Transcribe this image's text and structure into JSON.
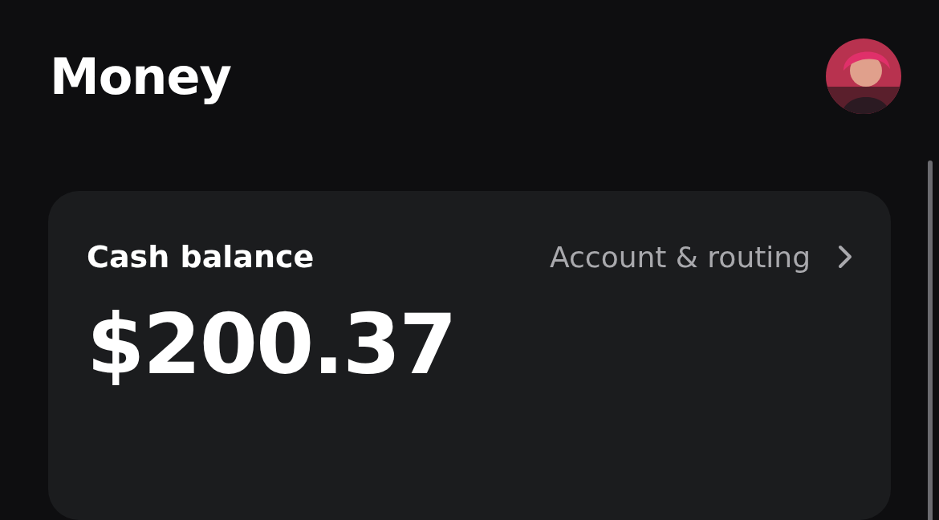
{
  "header": {
    "title": "Money"
  },
  "balance_card": {
    "label": "Cash balance",
    "link": "Account & routing",
    "amount": "$200.37"
  }
}
